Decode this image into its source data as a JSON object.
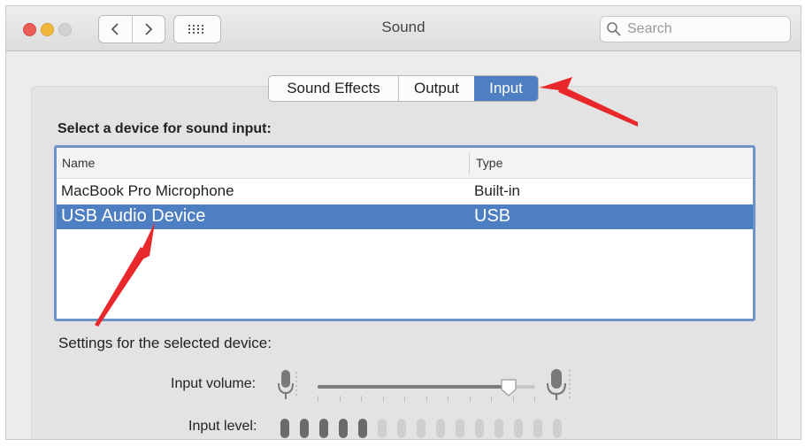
{
  "window": {
    "title": "Sound"
  },
  "search": {
    "placeholder": "Search"
  },
  "tabs": [
    {
      "label": "Sound Effects",
      "selected": false
    },
    {
      "label": "Output",
      "selected": false
    },
    {
      "label": "Input",
      "selected": true
    }
  ],
  "input": {
    "heading": "Select a device for sound input:",
    "columns": {
      "name": "Name",
      "type": "Type"
    },
    "devices": [
      {
        "name": "MacBook Pro Microphone",
        "type": "Built-in",
        "selected": false
      },
      {
        "name": "USB Audio Device",
        "type": "USB",
        "selected": true
      }
    ],
    "settings_label": "Settings for the selected device:",
    "volume_label": "Input volume:",
    "volume_value": 0.88,
    "level_label": "Input level:",
    "level_segments_total": 15,
    "level_segments_active": 5
  },
  "colors": {
    "accent": "#4f7fc3",
    "annotation_arrow": "#e8282a"
  },
  "icons": [
    "back-chevron-icon",
    "forward-chevron-icon",
    "grid-icon",
    "search-icon",
    "microphone-low-icon",
    "microphone-high-icon"
  ]
}
